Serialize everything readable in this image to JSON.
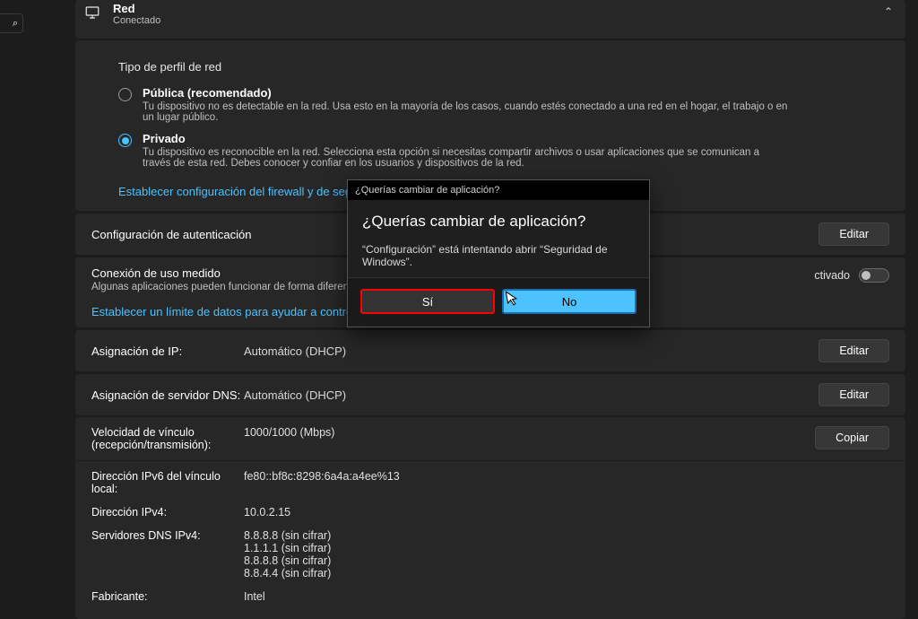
{
  "header": {
    "title": "Red",
    "subtitle": "Conectado"
  },
  "section_label": "Tipo de perfil de red",
  "profiles": {
    "public": {
      "label": "Pública (recomendado)",
      "desc": "Tu dispositivo no es detectable en la red. Usa esto en la mayoría de los casos, cuando estés conectado a una red en el hogar, el trabajo o en un lugar público."
    },
    "private": {
      "label": "Privado",
      "desc": "Tu dispositivo es reconocible en la red. Selecciona esta opción si necesitas compartir archivos o usar aplicaciones que se comunican a través de esta red. Debes conocer y confiar en los usuarios y dispositivos de la red."
    }
  },
  "links": {
    "firewall": "Establecer configuración del firewall y de seguridad",
    "datalimit": "Establecer un límite de datos para ayudar a controlar el us"
  },
  "rows": {
    "auth": {
      "title": "Configuración de autenticación",
      "btn": "Editar"
    },
    "metered": {
      "title": "Conexión de uso medido",
      "sub": "Algunas aplicaciones pueden funcionar de forma diferente para re",
      "toggle_label": "ctivado"
    },
    "ip": {
      "title": "Asignación de IP:",
      "value": "Automático (DHCP)",
      "btn": "Editar"
    },
    "dns": {
      "title": "Asignación de servidor DNS:",
      "value": "Automático (DHCP)",
      "btn": "Editar"
    }
  },
  "info": {
    "speed_key": "Velocidad de vínculo (recepción/transmisión):",
    "speed_val": "1000/1000 (Mbps)",
    "copy_btn": "Copiar",
    "ipv6_local_key": "Dirección IPv6 del vínculo local:",
    "ipv6_local_val": "fe80::bf8c:8298:6a4a:a4ee%13",
    "ipv4_key": "Dirección IPv4:",
    "ipv4_val": "10.0.2.15",
    "dns_key": "Servidores DNS IPv4:",
    "dns_vals": [
      "8.8.8.8 (sin cifrar)",
      "1.1.1.1 (sin cifrar)",
      "8.8.8.8 (sin cifrar)",
      "8.8.4.4 (sin cifrar)"
    ],
    "maker_key": "Fabricante:",
    "maker_val": "Intel"
  },
  "dialog": {
    "titlebar": "¿Querías cambiar de aplicación?",
    "heading": "¿Querías cambiar de aplicación?",
    "message": "“Configuración” está intentando abrir “Seguridad de Windows”.",
    "yes": "Sí",
    "no": "No"
  },
  "search_glyph": "⌕"
}
